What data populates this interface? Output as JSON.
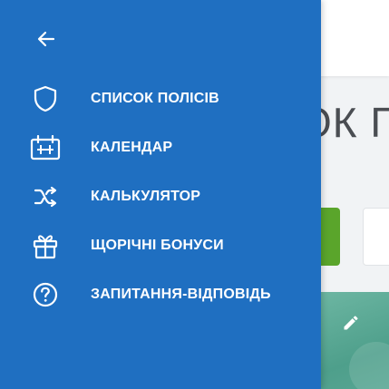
{
  "background": {
    "title_fragment": "ОК П"
  },
  "drawer": {
    "back_icon": "arrow-left-icon",
    "items": [
      {
        "label": "СПИСОК ПОЛІСІВ",
        "icon": "shield-icon"
      },
      {
        "label": "КАЛЕНДАР",
        "icon": "calendar-icon"
      },
      {
        "label": "КАЛЬКУЛЯТОР",
        "icon": "shuffle-icon"
      },
      {
        "label": "ЩОРІЧНІ БОНУСИ",
        "icon": "gift-icon"
      },
      {
        "label": "ЗАПИТАННЯ-ВІДПОВІДЬ",
        "icon": "help-circle-icon"
      }
    ]
  },
  "colors": {
    "drawer_bg": "#1f6fc1",
    "icon_stroke": "#ffffff",
    "accent_green": "#5aa52b",
    "accent_teal": "#5ba896"
  }
}
